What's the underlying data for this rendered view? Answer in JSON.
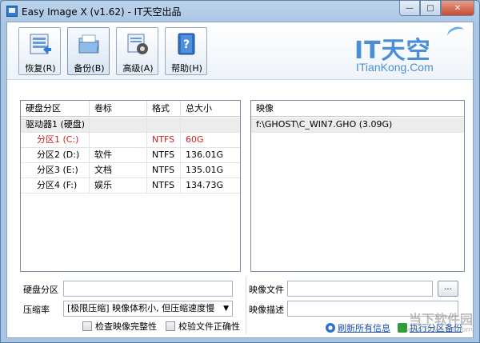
{
  "window": {
    "title": "Easy Image X (v1.62) - IT天空出品",
    "controls": {
      "minimize": "—",
      "maximize": "□",
      "close": "✕"
    }
  },
  "toolbar": {
    "buttons": [
      {
        "label": "恢复(R)",
        "icon": "restore-icon"
      },
      {
        "label": "备份(B)",
        "icon": "backup-folder-icon"
      },
      {
        "label": "高级(A)",
        "icon": "advanced-gear-icon"
      },
      {
        "label": "帮助(H)",
        "icon": "help-book-icon"
      }
    ]
  },
  "logo": {
    "main": "IT天空",
    "sub": "ITianKong.Com"
  },
  "partitions": {
    "headers": [
      "硬盘分区",
      "卷标",
      "格式",
      "总大小"
    ],
    "groups": [
      {
        "name": "驱动器1 (硬盘)"
      }
    ],
    "rows": [
      {
        "name": "分区1 (C:)",
        "label": "",
        "format": "NTFS",
        "size": "60G",
        "selected": true
      },
      {
        "name": "分区2 (D:)",
        "label": "软件",
        "format": "NTFS",
        "size": "136.01G",
        "selected": false
      },
      {
        "name": "分区3 (E:)",
        "label": "文档",
        "format": "NTFS",
        "size": "135.01G",
        "selected": false
      },
      {
        "name": "分区4 (F:)",
        "label": "娱乐",
        "format": "NTFS",
        "size": "134.73G",
        "selected": false
      }
    ]
  },
  "images": {
    "header": "映像",
    "rows": [
      {
        "path": "f:\\GHOST\\C_WIN7.GHO (3.09G)"
      }
    ]
  },
  "form": {
    "partition_label": "硬盘分区",
    "partition_value": "",
    "compression_label": "压缩率",
    "compression_value": "[极限压缩] 映像体积小, 但压缩速度慢",
    "check_integrity": "检查映像完整性",
    "check_file": "校验文件正确性",
    "image_file_label": "映像文件",
    "image_file_value": "",
    "browse_label": "...",
    "image_desc_label": "映像描述",
    "image_desc_value": "",
    "refresh_link": "刷新所有信息",
    "run_link": "执行分区备份"
  },
  "watermark": {
    "text": "当下软件园",
    "url": "www.downxia.com"
  },
  "colors": {
    "accent": "#4a8fd6",
    "selected_text": "#d02020"
  }
}
